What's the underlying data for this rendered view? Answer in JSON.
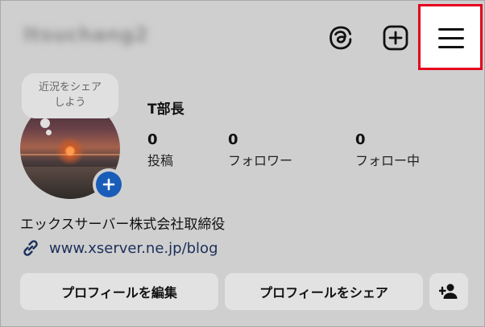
{
  "header": {
    "username": "Itsuchang2",
    "threads_icon": "threads-icon",
    "create_icon": "plus-square-icon",
    "menu_icon": "hamburger-menu-icon",
    "highlight_color": "#e5001c"
  },
  "note": {
    "line1": "近況をシェア",
    "line2": "しよう"
  },
  "profile": {
    "name": "T部長",
    "stats": [
      {
        "value": "0",
        "label": "投稿"
      },
      {
        "value": "0",
        "label": "フォロワー"
      },
      {
        "value": "0",
        "label": "フォロー中"
      }
    ],
    "bio": "エックスサーバー株式会社取締役",
    "link": "www.xserver.ne.jp/blog"
  },
  "actions": {
    "edit_profile": "プロフィールを編集",
    "share_profile": "プロフィールをシェア",
    "add_user_icon": "add-person-icon"
  },
  "colors": {
    "background": "#cfcfcf",
    "accent": "#1a5db8",
    "button_bg": "#e2e2e2"
  }
}
